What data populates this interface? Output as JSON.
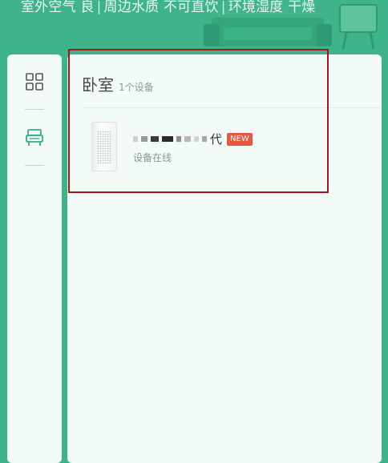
{
  "header": {
    "outdoor_air": "室外空气 良",
    "water_quality": "周边水质 不可直饮",
    "humidity": "环境湿度 干燥"
  },
  "sidebar": {
    "items": [
      {
        "icon": "grid-icon",
        "selected": false
      },
      {
        "icon": "bedroom-icon",
        "selected": true
      }
    ]
  },
  "room": {
    "name": "卧室",
    "device_count": "1个设备"
  },
  "device": {
    "name_suffix": "代",
    "badge": "NEW",
    "status": "设备在线"
  },
  "colors": {
    "header_bg": "#3fb48a",
    "panel_bg": "#f3fbf6",
    "accent": "#2fae80",
    "badge": "#e8573f",
    "highlight_border": "#a8141c"
  }
}
